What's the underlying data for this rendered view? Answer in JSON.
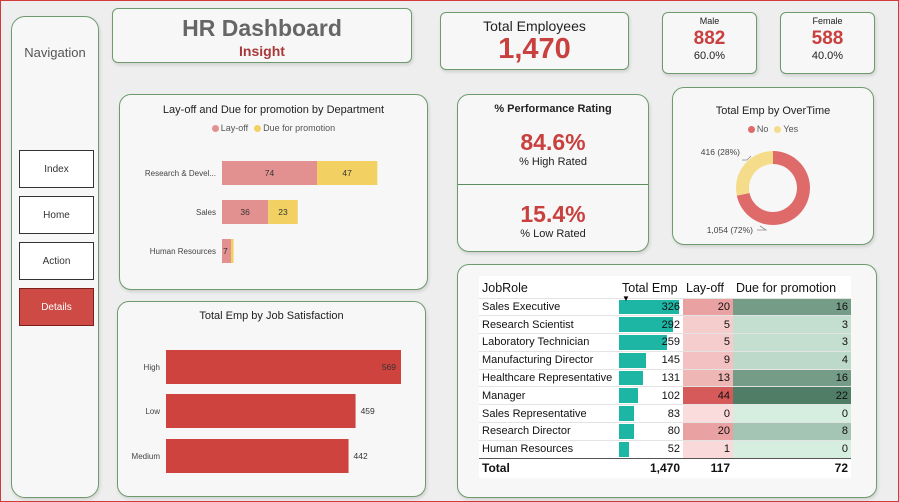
{
  "navigation": {
    "title": "Navigation",
    "items": [
      {
        "label": "Index",
        "active": false
      },
      {
        "label": "Home",
        "active": false
      },
      {
        "label": "Action",
        "active": false
      },
      {
        "label": "Details",
        "active": true
      }
    ]
  },
  "header": {
    "title": "HR Dashboard",
    "subtitle": "Insight"
  },
  "kpis": {
    "total_label": "Total Employees",
    "total_value": "1,470",
    "male_label": "Male",
    "male_value": "882",
    "male_pct": "60.0%",
    "female_label": "Female",
    "female_value": "588",
    "female_pct": "40.0%"
  },
  "performance": {
    "title": "% Performance Rating",
    "high_value": "84.6%",
    "high_label": "% High Rated",
    "low_value": "15.4%",
    "low_label": "% Low Rated"
  },
  "colors": {
    "accent_red": "#c9413f",
    "layoff": "#e39190",
    "promotion": "#f2d162",
    "satisfaction": "#cf433f",
    "donut_no": "#de6a6a",
    "donut_yes": "#f4dc8a",
    "teal": "#1db5a4"
  },
  "chart_data": [
    {
      "id": "dept",
      "type": "bar",
      "orientation": "horizontal",
      "stacked": true,
      "title": "Lay-off and Due for promotion by Department",
      "categories": [
        "Research & Devel...",
        "Sales",
        "Human Resources"
      ],
      "series": [
        {
          "name": "Lay-off",
          "values": [
            74,
            36,
            7
          ]
        },
        {
          "name": "Due for promotion",
          "values": [
            47,
            23,
            2
          ]
        }
      ],
      "legend_position": "top-center"
    },
    {
      "id": "satisfaction",
      "type": "bar",
      "orientation": "horizontal",
      "title": "Total Emp by Job Satisfaction",
      "categories": [
        "High",
        "Low",
        "Medium"
      ],
      "values": [
        569,
        459,
        442
      ]
    },
    {
      "id": "overtime",
      "type": "pie",
      "donut": true,
      "title": "Total Emp by OverTime",
      "labels": [
        "No",
        "Yes"
      ],
      "values": [
        1054,
        416
      ],
      "data_labels": [
        "1,054 (72%)",
        "416 (28%)"
      ],
      "legend_position": "top-center"
    },
    {
      "id": "jobrole",
      "type": "table",
      "columns": [
        "JobRole",
        "Total Emp",
        "Lay-off",
        "Due for promotion"
      ],
      "sorted_by": "Total Emp",
      "rows": [
        {
          "role": "Sales Executive",
          "total": 326,
          "layoff": 20,
          "promotion": 16
        },
        {
          "role": "Research Scientist",
          "total": 292,
          "layoff": 5,
          "promotion": 3
        },
        {
          "role": "Laboratory Technician",
          "total": 259,
          "layoff": 5,
          "promotion": 3
        },
        {
          "role": "Manufacturing Director",
          "total": 145,
          "layoff": 9,
          "promotion": 4
        },
        {
          "role": "Healthcare Representative",
          "total": 131,
          "layoff": 13,
          "promotion": 16
        },
        {
          "role": "Manager",
          "total": 102,
          "layoff": 44,
          "promotion": 22
        },
        {
          "role": "Sales Representative",
          "total": 83,
          "layoff": 0,
          "promotion": 0
        },
        {
          "role": "Research Director",
          "total": 80,
          "layoff": 20,
          "promotion": 8
        },
        {
          "role": "Human Resources",
          "total": 52,
          "layoff": 1,
          "promotion": 0
        }
      ],
      "totals": {
        "label": "Total",
        "total": "1,470",
        "layoff": "117",
        "promotion": "72"
      }
    }
  ]
}
